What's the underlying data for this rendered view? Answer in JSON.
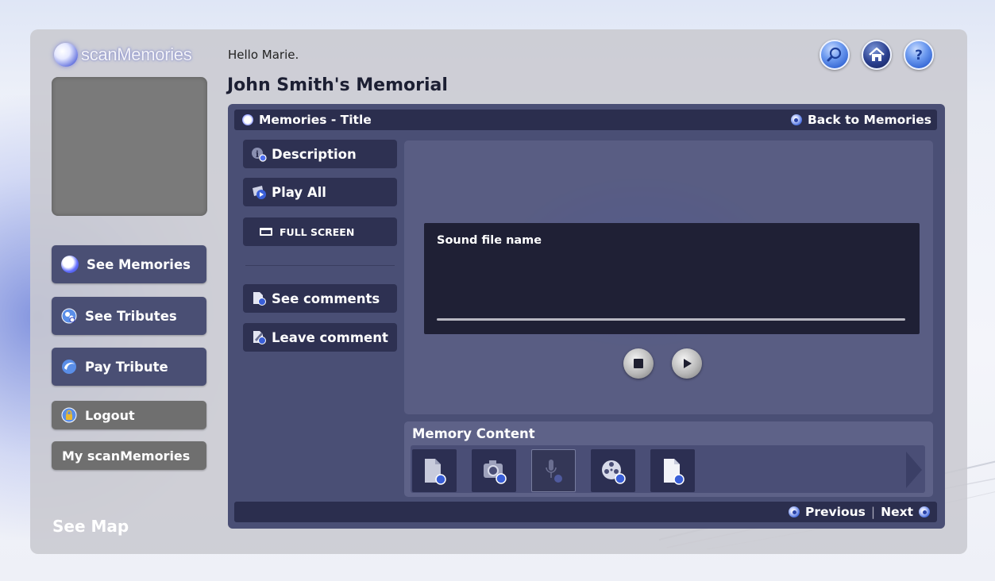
{
  "app": {
    "logo_text": "scanMemories",
    "greeting": "Hello Marie.",
    "page_title": "John Smith's Memorial"
  },
  "top_icons": [
    "search-icon",
    "home-icon",
    "help-icon"
  ],
  "sidebar": {
    "items": [
      {
        "label": "See Memories",
        "icon": "orb-icon"
      },
      {
        "label": "See Tributes",
        "icon": "tributes-icon"
      },
      {
        "label": "Pay Tribute",
        "icon": "pay-tribute-icon"
      },
      {
        "label": "Logout",
        "icon": "lock-icon"
      },
      {
        "label": "My scanMemories"
      }
    ],
    "see_map": "See Map"
  },
  "panel": {
    "title": "Memories - Title",
    "back_link": "Back to Memories",
    "menu": {
      "description": "Description",
      "play_all": "Play All",
      "full_screen": "FULL SCREEN",
      "see_comments": "See comments",
      "leave_comment": "Leave comment"
    },
    "player": {
      "sound_file": "Sound file name",
      "progress": 0
    },
    "memory_content": {
      "title": "Memory Content",
      "thumbnails": [
        "document-icon",
        "camera-icon",
        "microphone-icon",
        "film-reel-icon",
        "page-icon"
      ],
      "selected_index": 2
    },
    "pager": {
      "previous": "Previous",
      "separator": "|",
      "next": "Next"
    }
  },
  "colors": {
    "panel": "#4a4f75",
    "header_bar": "#2b2e4e",
    "frame": "#cacad0",
    "accent_blue": "#3b48c0"
  }
}
